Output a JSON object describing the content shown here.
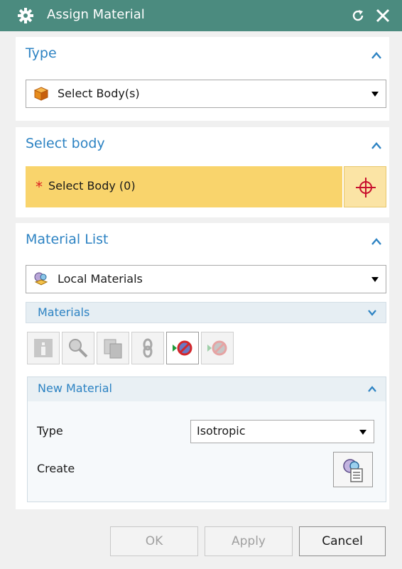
{
  "window": {
    "title": "Assign Material",
    "icons": {
      "gear": "gear-icon",
      "reset": "reset-icon",
      "close": "close-icon"
    },
    "colors": {
      "titlebar": "#4b8b7f",
      "accent": "#2d83c3",
      "selection": "#f9d46c"
    }
  },
  "type_section": {
    "title": "Type",
    "dropdown": {
      "value": "Select Body(s)",
      "icon": "cube-icon"
    }
  },
  "select_section": {
    "title": "Select body",
    "selection_label": "Select Body (0)",
    "required_mark": "*"
  },
  "material_section": {
    "title": "Material List",
    "dropdown": {
      "value": "Local Materials",
      "icon": "local-materials-icon"
    },
    "materials_header": "Materials",
    "toolbar": [
      {
        "name": "info-icon",
        "enabled": false
      },
      {
        "name": "inspect-icon",
        "enabled": false
      },
      {
        "name": "copy-icon",
        "enabled": false
      },
      {
        "name": "link-icon",
        "enabled": false
      },
      {
        "name": "assign-material-icon",
        "enabled": true
      },
      {
        "name": "remove-material-icon",
        "enabled": false
      }
    ],
    "new_material": {
      "title": "New Material",
      "type_label": "Type",
      "type_value": "Isotropic",
      "create_label": "Create"
    }
  },
  "footer": {
    "ok": "OK",
    "apply": "Apply",
    "cancel": "Cancel"
  }
}
